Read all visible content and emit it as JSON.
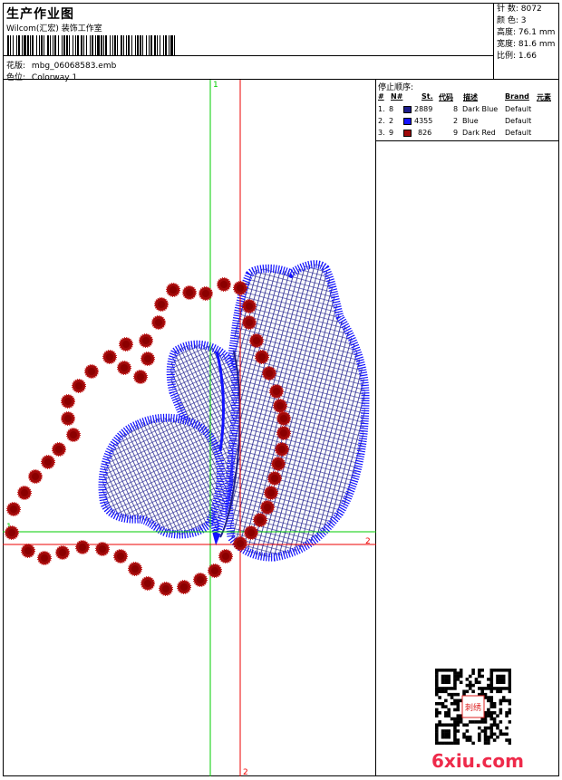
{
  "header": {
    "title": "生产作业图",
    "company": "Wilcom(汇宏) 装饰工作室",
    "design_label": "花版:",
    "design_value": "mbg_06068583.emb",
    "colorway_label": "色位:",
    "colorway_value": "Colorway 1"
  },
  "stats": [
    {
      "label": "针 数:",
      "value": "8072"
    },
    {
      "label": "颜 色:",
      "value": "3"
    },
    {
      "label": "高度:",
      "value": "76.1 mm"
    },
    {
      "label": "宽度:",
      "value": "81.6 mm"
    },
    {
      "label": "比例:",
      "value": "1.66"
    }
  ],
  "stop_sequence": {
    "label": "停止顺序:",
    "columns": [
      "#",
      "N#",
      "St.",
      "代码",
      "描述",
      "Brand",
      "元素"
    ],
    "rows": [
      {
        "index": "1.",
        "needle": "8",
        "stitches": "2889",
        "code": "8",
        "description": "Dark Blue",
        "brand": "Default",
        "color": "#1e1e8c"
      },
      {
        "index": "2.",
        "needle": "2",
        "stitches": "4355",
        "code": "2",
        "description": "Blue",
        "brand": "Default",
        "color": "#1414ff"
      },
      {
        "index": "3.",
        "needle": "9",
        "stitches": "826",
        "code": "9",
        "description": "Dark Red",
        "brand": "Default",
        "color": "#a00a0a"
      }
    ]
  },
  "guides": {
    "green_label": "1",
    "red_label": "2",
    "green_color": "#00cc00",
    "red_color": "#ee0000"
  },
  "watermark": "6xiu.com",
  "qr_seal_text": "刺绣"
}
